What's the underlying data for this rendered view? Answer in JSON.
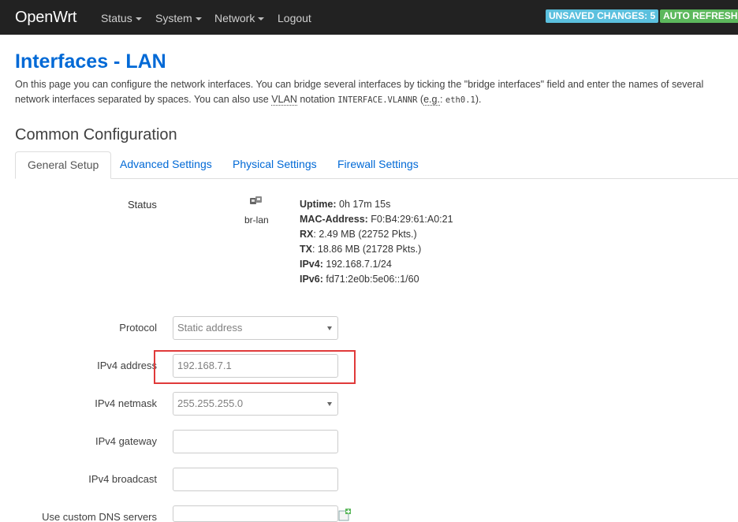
{
  "navbar": {
    "brand": "OpenWrt",
    "menu": [
      {
        "label": "Status",
        "dropdown": true
      },
      {
        "label": "System",
        "dropdown": true
      },
      {
        "label": "Network",
        "dropdown": true
      },
      {
        "label": "Logout",
        "dropdown": false
      }
    ],
    "badges": {
      "unsaved": "UNSAVED CHANGES: 5",
      "auto_refresh": "AUTO REFRESH"
    }
  },
  "page": {
    "title": "Interfaces - LAN",
    "description_part1": "On this page you can configure the network interfaces. You can bridge several interfaces by ticking the \"bridge interfaces\" field and enter the names of several network interfaces separated by spaces. You can also use ",
    "vlan_abbr": "VLAN",
    "description_part2": " notation ",
    "notation_code": "INTERFACE.VLANNR",
    "description_part3": " (",
    "eg_abbr": "e.g.",
    "description_part4": ": ",
    "example_code": "eth0.1",
    "description_part5": ")."
  },
  "section": {
    "title": "Common Configuration"
  },
  "tabs": [
    {
      "label": "General Setup",
      "active": true
    },
    {
      "label": "Advanced Settings",
      "active": false
    },
    {
      "label": "Physical Settings",
      "active": false
    },
    {
      "label": "Firewall Settings",
      "active": false
    }
  ],
  "status": {
    "label": "Status",
    "device": "br-lan",
    "icon": "ethernet-bridge-icon",
    "uptime_label": "Uptime:",
    "uptime": "0h 17m 15s",
    "mac_label": "MAC-Address:",
    "mac": "F0:B4:29:61:A0:21",
    "rx_label": "RX",
    "rx": ": 2.49 MB (22752 Pkts.)",
    "tx_label": "TX",
    "tx": ": 18.86 MB (21728 Pkts.)",
    "ipv4_label": "IPv4:",
    "ipv4": "192.168.7.1/24",
    "ipv6_label": "IPv6:",
    "ipv6": "fd71:2e0b:5e06::1/60"
  },
  "form": {
    "protocol": {
      "label": "Protocol",
      "value": "Static address"
    },
    "ipv4_address": {
      "label": "IPv4 address",
      "value": "192.168.7.1"
    },
    "ipv4_netmask": {
      "label": "IPv4 netmask",
      "value": "255.255.255.0"
    },
    "ipv4_gateway": {
      "label": "IPv4 gateway",
      "value": ""
    },
    "ipv4_broadcast": {
      "label": "IPv4 broadcast",
      "value": ""
    },
    "dns_servers": {
      "label": "Use custom DNS servers",
      "value": "",
      "add_icon": "add-entry-icon"
    }
  },
  "colors": {
    "navbar_bg": "#222222",
    "link": "#0069d6",
    "badge_unsaved": "#5bc0de",
    "badge_refresh": "#5cb85c",
    "highlight": "#e03a3a"
  }
}
